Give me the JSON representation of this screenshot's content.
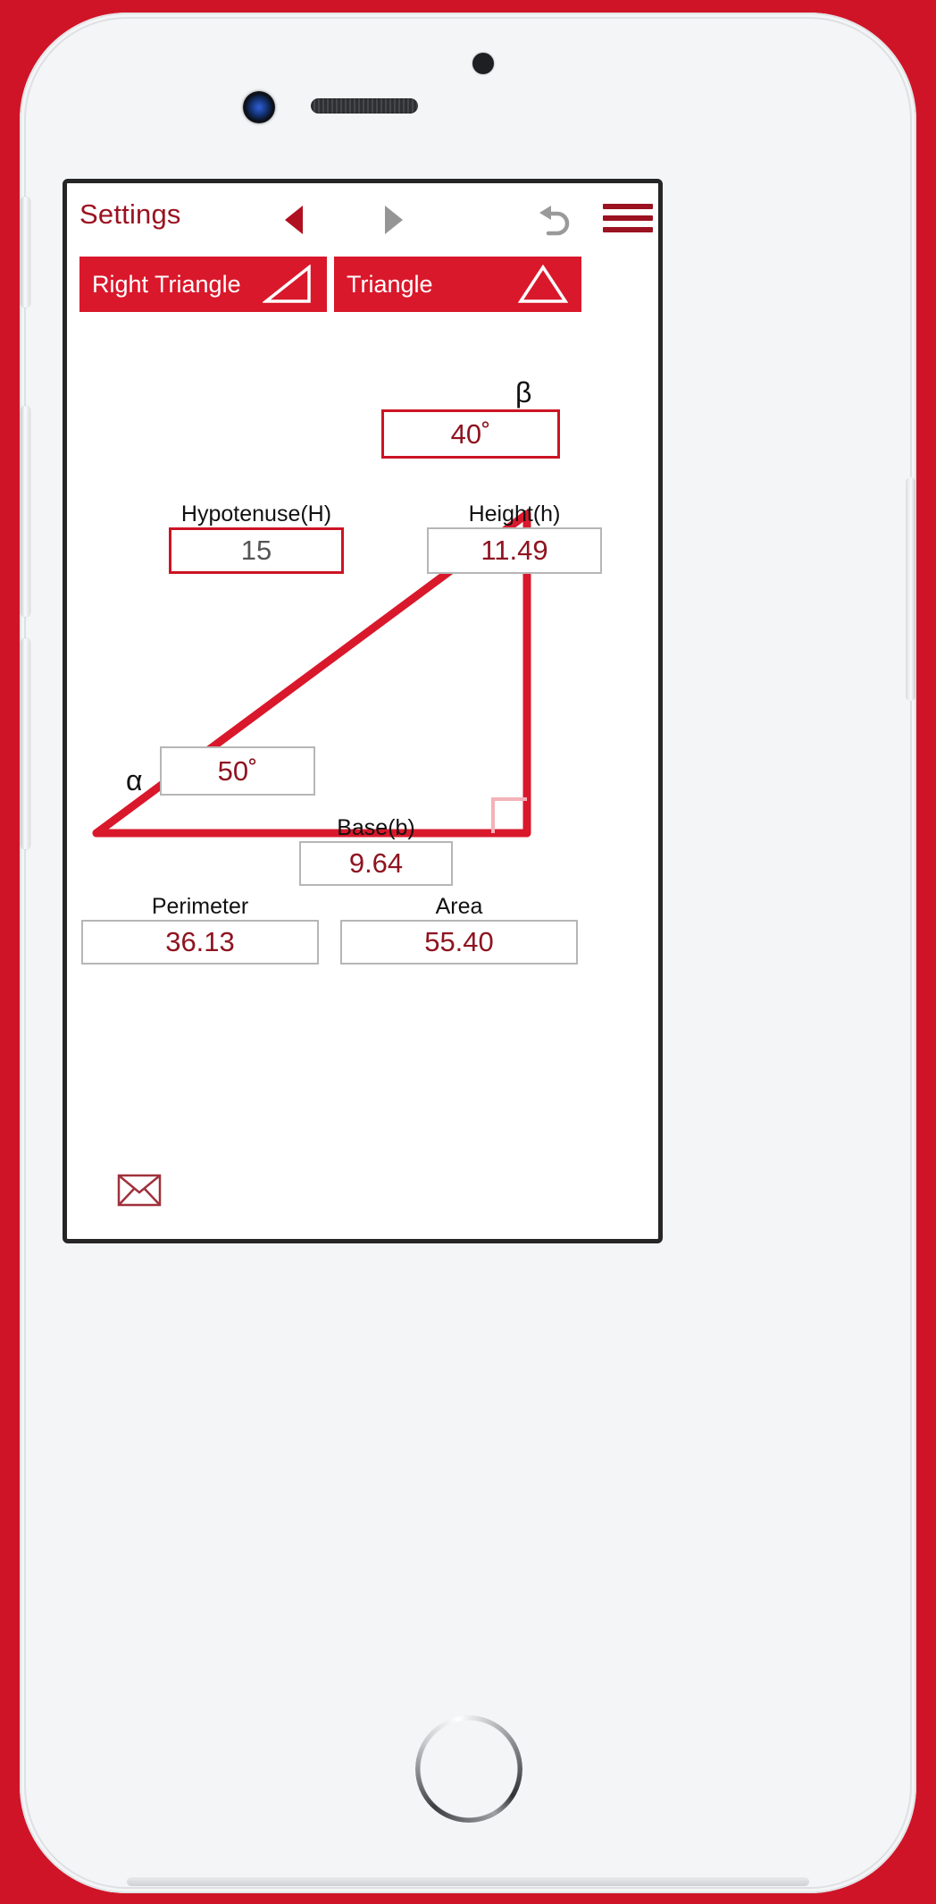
{
  "device": {
    "name": "smartphone-mockup",
    "sensors": [
      "proximity-sensor-dot",
      "front-camera",
      "earpiece-speaker"
    ],
    "home_button_label": "",
    "frame_color": "#f4f5f7",
    "background_color": "#d01427"
  },
  "toolbar": {
    "settings_label": "Settings",
    "prev_icon": "triangle-left-icon",
    "next_icon": "triangle-right-icon",
    "undo_icon": "undo-arrow-icon",
    "menu_icon": "hamburger-menu-icon",
    "accent_color": "#9b1220",
    "inactive_color": "#959595"
  },
  "tabs": [
    {
      "label": "Right Triangle",
      "icon": "right-triangle-icon",
      "active": true
    },
    {
      "label": "Triangle",
      "icon": "triangle-icon",
      "active": true
    }
  ],
  "diagram": {
    "angle_alpha_symbol": "α",
    "angle_beta_symbol": "β",
    "right_angle_marker": "right-angle-square",
    "stroke_color": "#d9182b"
  },
  "fields": {
    "beta": {
      "label": "",
      "value": "40˚",
      "border": "red",
      "kind": "input"
    },
    "hypotenuse": {
      "label": "Hypotenuse(H)",
      "value": "15",
      "border": "red",
      "kind": "input"
    },
    "height": {
      "label": "Height(h)",
      "value": "11.49",
      "border": "gray",
      "kind": "calculated"
    },
    "alpha": {
      "label": "",
      "value": "50˚",
      "border": "gray",
      "kind": "calculated"
    },
    "base": {
      "label": "Base(b)",
      "value": "9.64",
      "border": "gray",
      "kind": "calculated"
    },
    "perimeter": {
      "label": "Perimeter",
      "value": "36.13",
      "border": "gray",
      "kind": "calculated"
    },
    "area": {
      "label": "Area",
      "value": "55.40",
      "border": "gray",
      "kind": "calculated"
    }
  },
  "footer": {
    "mail_icon": "envelope-icon"
  },
  "colors": {
    "brand_red": "#d9182b",
    "dark_red": "#8e1420",
    "input_text": "#555555",
    "border_gray": "#b6b6b6"
  }
}
